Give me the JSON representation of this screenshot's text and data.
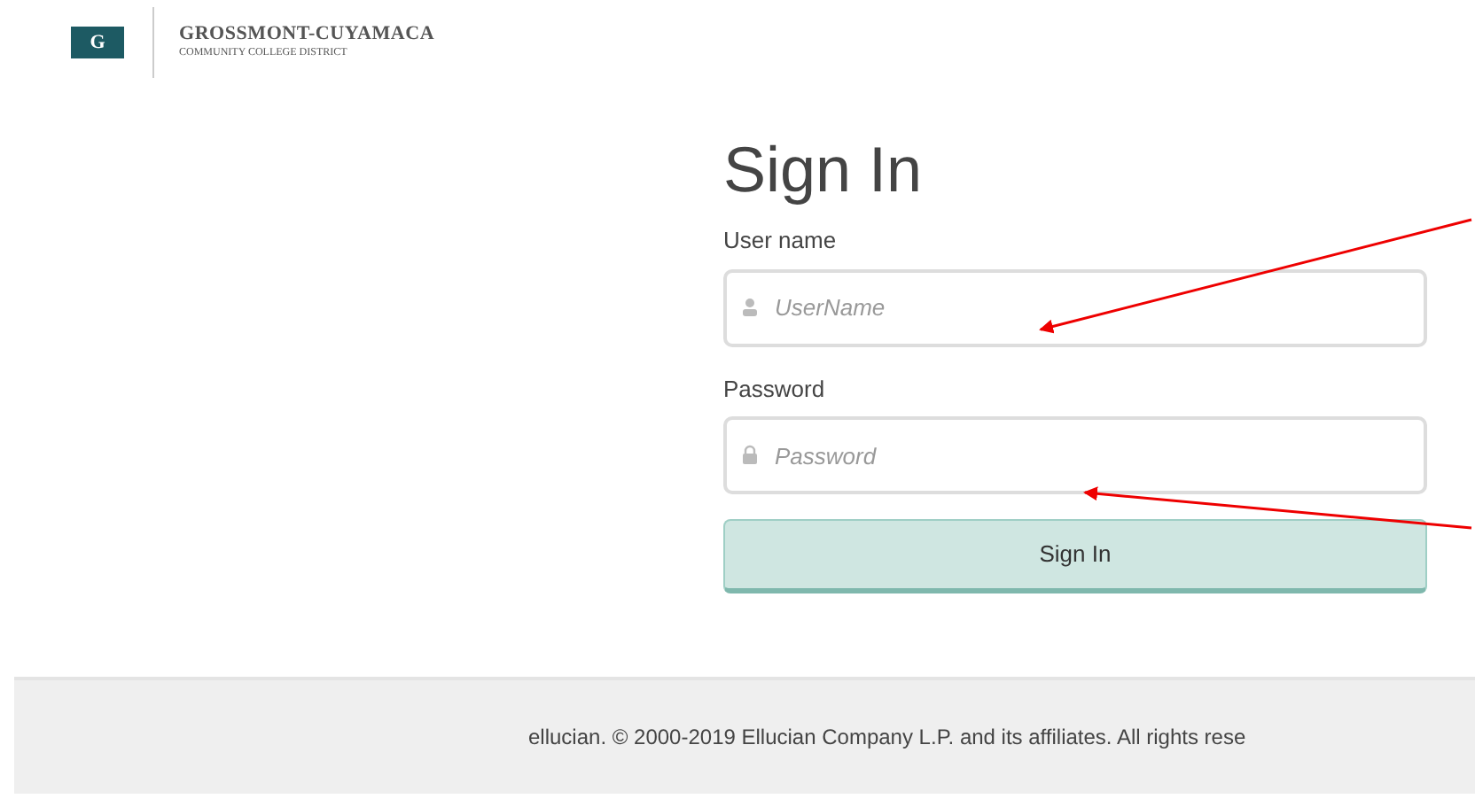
{
  "header": {
    "logo_mark": "G",
    "organization": "GROSSMONT-CUYAMACA",
    "subtitle": "COMMUNITY COLLEGE DISTRICT"
  },
  "form": {
    "title": "Sign In",
    "fields": [
      {
        "label": "User name",
        "placeholder": "UserName",
        "kind": "user"
      },
      {
        "label": "Password",
        "placeholder": "Password",
        "kind": "password"
      }
    ],
    "submit": "Sign In"
  },
  "footer": {
    "text": "ellucian. © 2000-2019 Ellucian Company L.P. and its affiliates. All rights rese"
  }
}
